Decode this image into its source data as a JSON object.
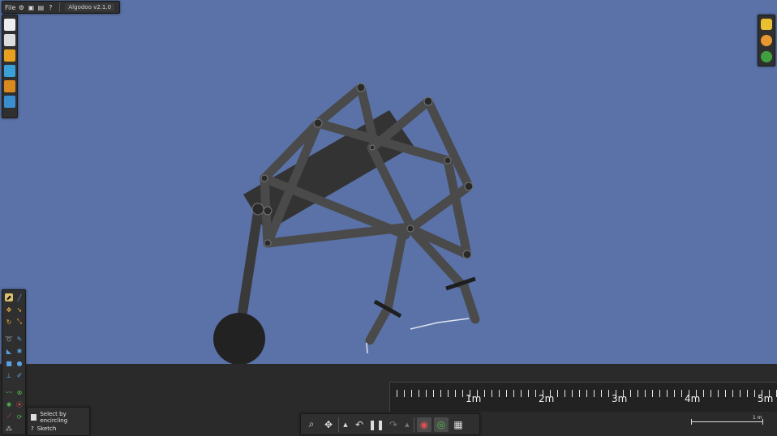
{
  "menu": {
    "file_label": "File",
    "version": "Algodoo v2.1.0"
  },
  "ruler": {
    "labels": [
      "1m",
      "2m",
      "3m",
      "4m",
      "5m"
    ]
  },
  "tool_options": {
    "select_by_encircling": "Select by encircling",
    "sketch": "Sketch"
  },
  "scale_bar": {
    "label": "1 m"
  },
  "colors": {
    "background": "#5a72a8",
    "ground": "#2a2a2a",
    "panel": "#2f2f2f",
    "beam": "#4a4a4a",
    "body": "#333333",
    "wheel": "#222222"
  },
  "icons": {
    "top": [
      "gear-icon",
      "window-icon",
      "scene-icon",
      "help-icon"
    ],
    "file": [
      "new-scene-icon",
      "reset-icon",
      "open-folder-icon",
      "open-online-icon",
      "save-icon",
      "save-as-icon"
    ],
    "right": [
      "layers-icon",
      "palette-icon",
      "zoom-icon"
    ],
    "playback": [
      "zoom-tool-icon",
      "pan-tool-icon",
      "undo-icon",
      "pause-icon",
      "redo-icon",
      "sim-icon-1",
      "sim-icon-2",
      "grid-icon"
    ]
  }
}
